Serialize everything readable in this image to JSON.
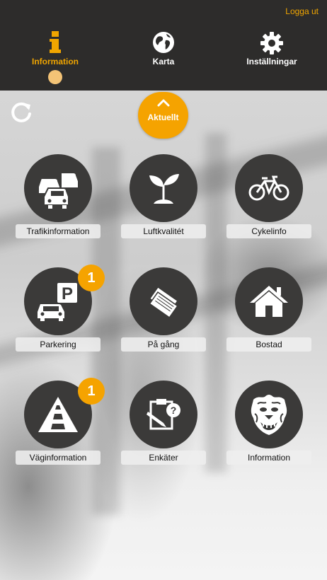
{
  "header": {
    "logout_label": "Logga ut",
    "nav": [
      {
        "label": "Information",
        "icon": "info-icon",
        "active": true
      },
      {
        "label": "Karta",
        "icon": "globe-icon",
        "active": false
      },
      {
        "label": "Inställningar",
        "icon": "gear-icon",
        "active": false
      }
    ]
  },
  "aktuellt": {
    "label": "Aktuellt",
    "icon": "chevron-up-icon"
  },
  "refresh": {
    "icon": "refresh-icon"
  },
  "tiles": [
    {
      "label": "Trafikinformation",
      "icon": "cars-icon",
      "badge": ""
    },
    {
      "label": "Luftkvalitét",
      "icon": "plant-icon",
      "badge": ""
    },
    {
      "label": "Cykelinfo",
      "icon": "bicycle-icon",
      "badge": ""
    },
    {
      "label": "Parkering",
      "icon": "parking-car-icon",
      "badge": "1"
    },
    {
      "label": "På gång",
      "icon": "tickets-icon",
      "badge": ""
    },
    {
      "label": "Bostad",
      "icon": "house-icon",
      "badge": ""
    },
    {
      "label": "Väginformation",
      "icon": "road-warning-icon",
      "badge": "1"
    },
    {
      "label": "Enkäter",
      "icon": "survey-icon",
      "badge": ""
    },
    {
      "label": "Information",
      "icon": "lion-crest-icon",
      "badge": ""
    }
  ],
  "colors": {
    "accent": "#f5a300",
    "header_bg": "#2d2c2b",
    "tile_bg": "#3b3a39",
    "nav_dot": "#f3c376"
  }
}
